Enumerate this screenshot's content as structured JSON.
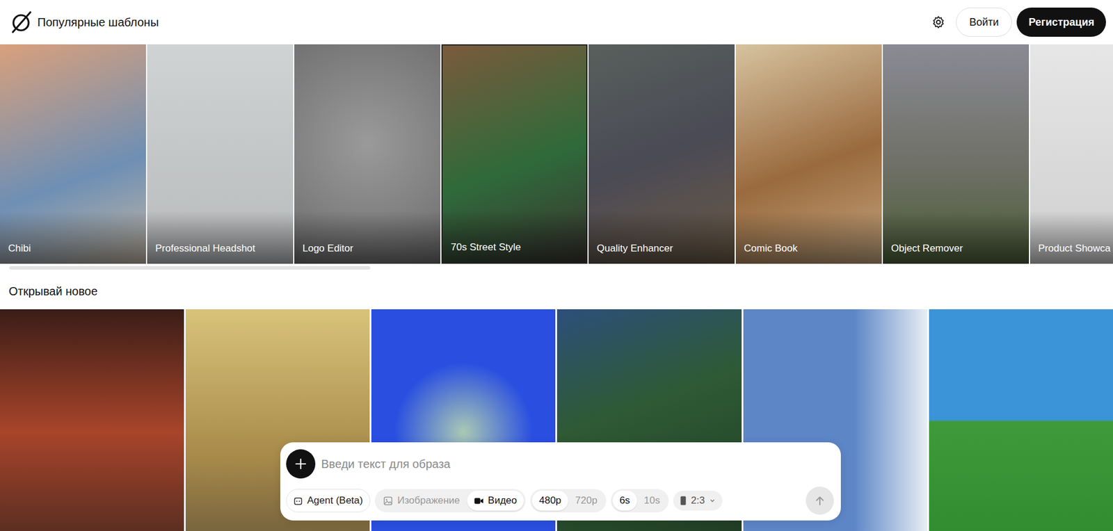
{
  "header": {
    "title": "Популярные шаблоны",
    "login": "Войти",
    "register": "Регистрация"
  },
  "templates": [
    {
      "label": "Chibi"
    },
    {
      "label": "Professional Headshot"
    },
    {
      "label": "Logo Editor"
    },
    {
      "label": "70s Street Style"
    },
    {
      "label": "Quality Enhancer"
    },
    {
      "label": "Comic Book"
    },
    {
      "label": "Object Remover"
    },
    {
      "label": "Product Showca"
    }
  ],
  "discover": {
    "title": "Открывай новое"
  },
  "prompt": {
    "placeholder": "Введи текст для образа",
    "agent": "Agent (Beta)",
    "modes": [
      {
        "label": "Изображение",
        "selected": false
      },
      {
        "label": "Видео",
        "selected": true
      }
    ],
    "resolutions": [
      {
        "label": "480p",
        "selected": true
      },
      {
        "label": "720p",
        "selected": false
      }
    ],
    "durations": [
      {
        "label": "6s",
        "selected": true
      },
      {
        "label": "10s",
        "selected": false
      }
    ],
    "aspect": "2:3"
  }
}
